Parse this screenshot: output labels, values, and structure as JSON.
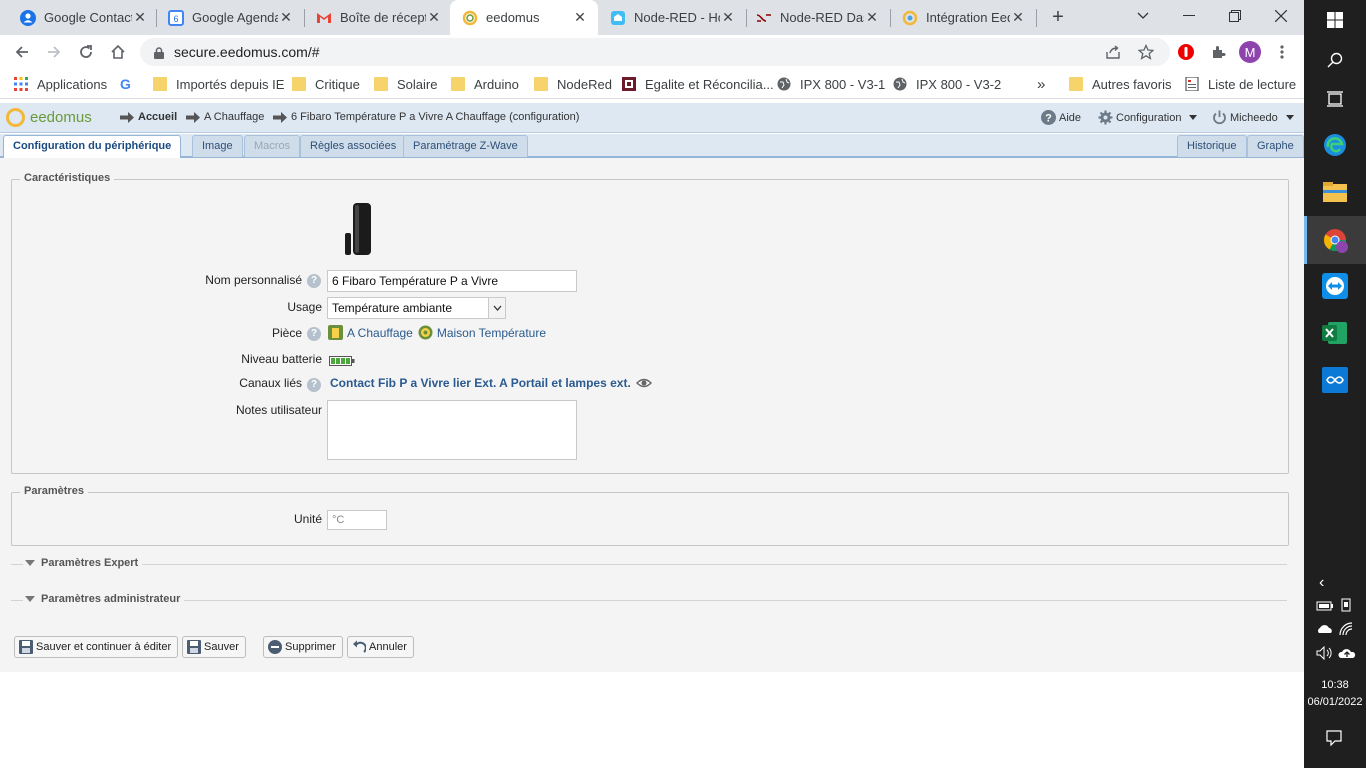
{
  "browser": {
    "tabs": [
      {
        "title": "Google Contacts",
        "icon": "google-contacts-icon",
        "active": false
      },
      {
        "title": "Google Agenda",
        "icon": "google-calendar-icon",
        "active": false
      },
      {
        "title": "Boîte de réception",
        "icon": "gmail-icon",
        "active": false
      },
      {
        "title": "eedomus",
        "icon": "eedomus-icon",
        "active": true
      },
      {
        "title": "Node-RED - Ho",
        "icon": "home-assistant-icon",
        "active": false
      },
      {
        "title": "Node-RED Dash",
        "icon": "node-red-icon",
        "active": false
      },
      {
        "title": "Intégration Eed",
        "icon": "integration-icon",
        "active": false
      }
    ],
    "new_tab": "+",
    "url": "secure.eedomus.com/#",
    "profile_initial": "M",
    "bookmarks": [
      {
        "label": "Applications",
        "icon": "apps-grid-icon"
      },
      {
        "label": "",
        "icon": "google-icon"
      },
      {
        "label": "Importés depuis IE",
        "icon": "folder-icon"
      },
      {
        "label": "Critique",
        "icon": "folder-icon"
      },
      {
        "label": "Solaire",
        "icon": "folder-icon"
      },
      {
        "label": "Arduino",
        "icon": "folder-icon"
      },
      {
        "label": "NodeRed",
        "icon": "folder-icon"
      },
      {
        "label": "Egalite et Réconcilia...",
        "icon": "site-icon"
      },
      {
        "label": "IPX 800 - V3-1",
        "icon": "globe-icon"
      },
      {
        "label": "IPX 800 - V3-2",
        "icon": "globe-icon"
      }
    ],
    "more_bookmarks": "»",
    "other_favorites": "Autres favoris",
    "reading_list": "Liste de lecture"
  },
  "app": {
    "logo_text": "eedomus",
    "breadcrumb": [
      "Accueil",
      "A Chauffage",
      "6 Fibaro Température P a Vivre A Chauffage (configuration)"
    ],
    "help_label": "Aide",
    "config_label": "Configuration",
    "user_label": "Micheedo",
    "tabs": [
      {
        "label": "Configuration du périphérique",
        "state": "active"
      },
      {
        "label": "Image",
        "state": "normal"
      },
      {
        "label": "Macros",
        "state": "disabled"
      },
      {
        "label": "Règles associées",
        "state": "normal"
      },
      {
        "label": "Paramétrage Z-Wave",
        "state": "normal"
      }
    ],
    "right_tabs": [
      "Historique",
      "Graphe"
    ],
    "characteristics": {
      "legend": "Caractéristiques",
      "name_label": "Nom personnalisé",
      "name_value": "6  Fibaro Température P a Vivre",
      "usage_label": "Usage",
      "usage_value": "Température ambiante",
      "room_label": "Pièce",
      "room_links": [
        "A Chauffage",
        "Maison Température"
      ],
      "battery_label": "Niveau batterie",
      "channels_label": "Canaux liés",
      "channels_value": "Contact Fib P a Vivre lier Ext. A Portail et lampes ext.",
      "notes_label": "Notes utilisateur",
      "notes_value": ""
    },
    "parameters": {
      "legend": "Paramètres",
      "unit_label": "Unité",
      "unit_value": "°C"
    },
    "expert_label": "Paramètres Expert",
    "admin_label": "Paramètres administrateur",
    "buttons": {
      "save_continue": "Sauver et continuer à éditer",
      "save": "Sauver",
      "delete": "Supprimer",
      "cancel": "Annuler"
    }
  },
  "taskbar": {
    "time": "10:38",
    "date": "06/01/2022"
  }
}
